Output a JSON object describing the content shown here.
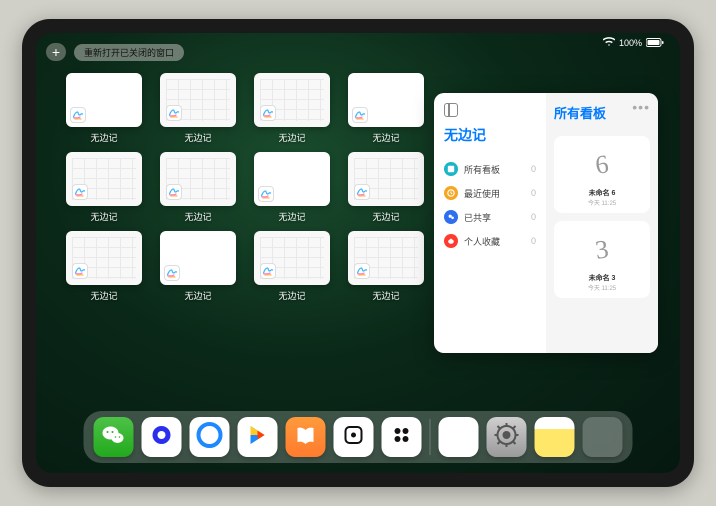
{
  "status": {
    "battery": "100%"
  },
  "topbar": {
    "plus_label": "+",
    "reopen_label": "重新打开已关闭的窗口"
  },
  "app_name": "无边记",
  "thumbs": [
    {
      "label": "无边记",
      "style": "blank"
    },
    {
      "label": "无边记",
      "style": "calendar"
    },
    {
      "label": "无边记",
      "style": "calendar"
    },
    {
      "label": "无边记",
      "style": "blank"
    },
    {
      "label": "无边记",
      "style": "calendar"
    },
    {
      "label": "无边记",
      "style": "calendar"
    },
    {
      "label": "无边记",
      "style": "blank"
    },
    {
      "label": "无边记",
      "style": "calendar"
    },
    {
      "label": "无边记",
      "style": "calendar"
    },
    {
      "label": "无边记",
      "style": "blank"
    },
    {
      "label": "无边记",
      "style": "calendar"
    },
    {
      "label": "无边记",
      "style": "calendar"
    }
  ],
  "panel": {
    "left_title": "无边记",
    "right_title": "所有看板",
    "filters": [
      {
        "label": "所有看板",
        "count": "0",
        "color": "#18b6c6"
      },
      {
        "label": "最近使用",
        "count": "0",
        "color": "#f6a623"
      },
      {
        "label": "已共享",
        "count": "0",
        "color": "#2e6ff0"
      },
      {
        "label": "个人收藏",
        "count": "0",
        "color": "#ff3b30"
      }
    ],
    "boards": [
      {
        "name": "未命名 6",
        "date": "今天 11:25",
        "glyph": "6"
      },
      {
        "name": "未命名 3",
        "date": "今天 11:25",
        "glyph": "3"
      }
    ]
  },
  "dock": {
    "items": [
      {
        "name": "wechat"
      },
      {
        "name": "quark"
      },
      {
        "name": "qq"
      },
      {
        "name": "play"
      },
      {
        "name": "books"
      },
      {
        "name": "dice"
      },
      {
        "name": "dots4"
      }
    ],
    "recents": [
      {
        "name": "freeform"
      },
      {
        "name": "settings"
      },
      {
        "name": "notes"
      },
      {
        "name": "folder"
      }
    ]
  }
}
